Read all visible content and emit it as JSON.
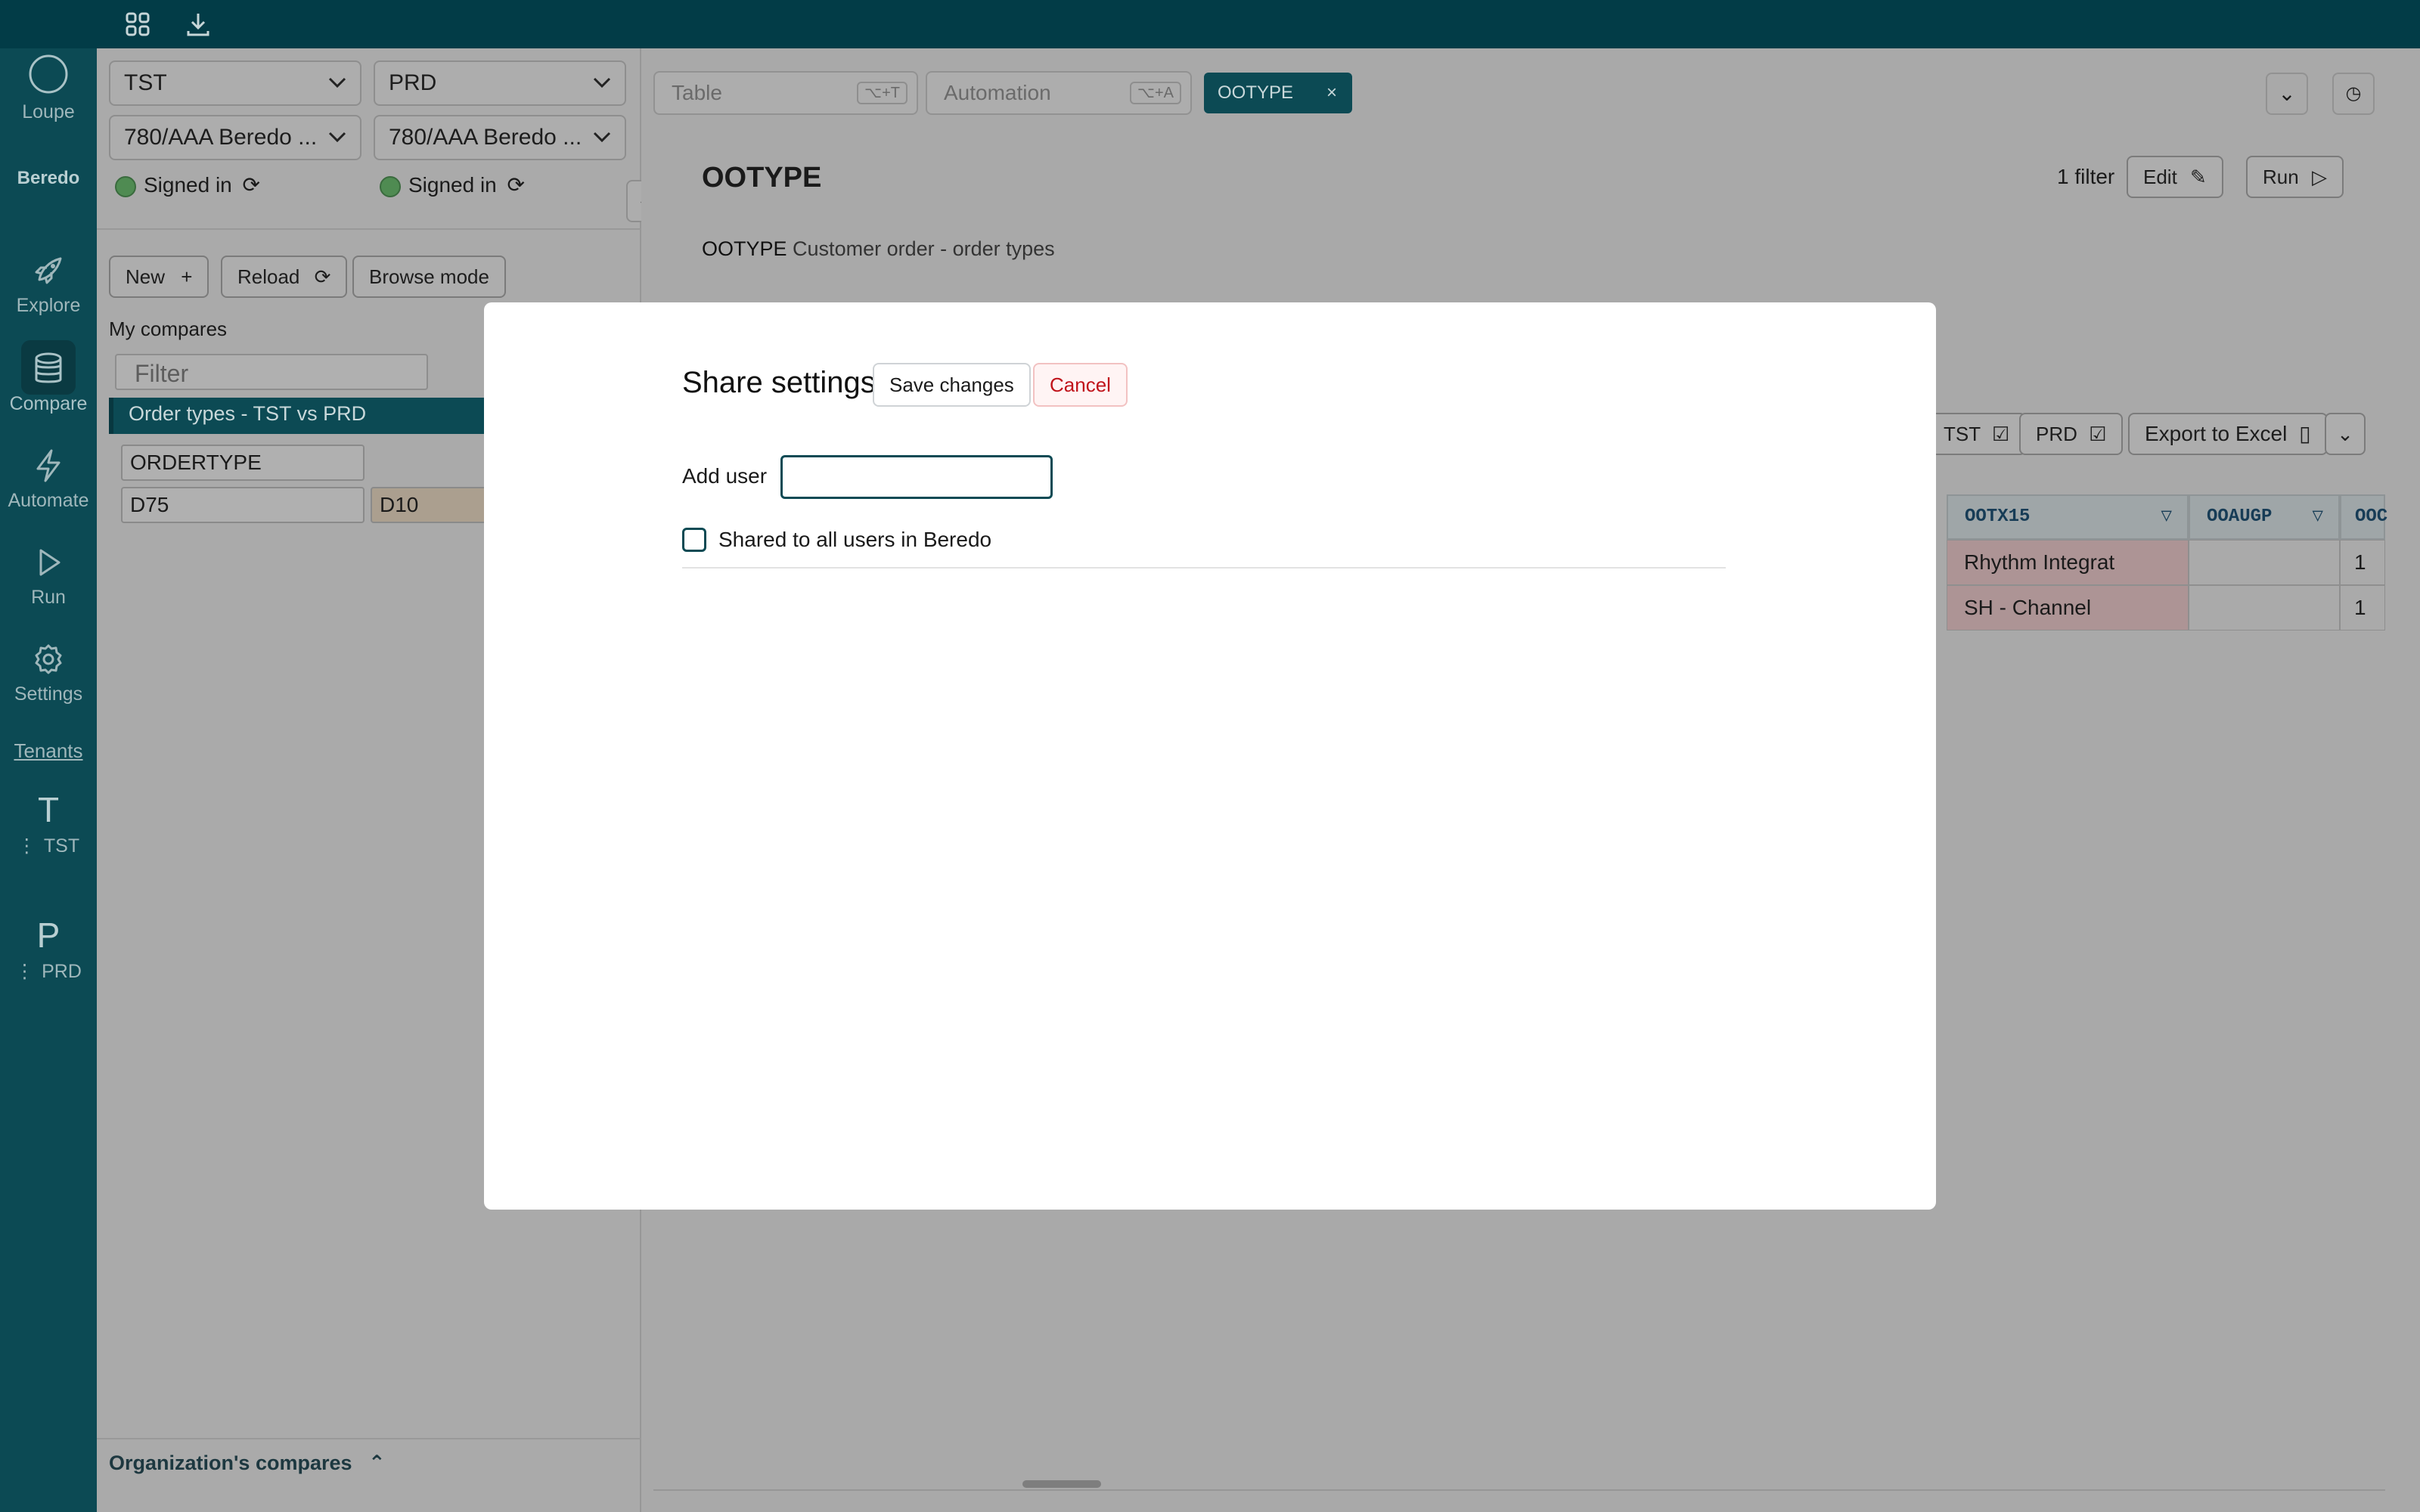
{
  "nav": {
    "brand_top": "Loupe",
    "brand_name": "Beredo",
    "items": [
      {
        "label": "Explore",
        "icon": "rocket-icon"
      },
      {
        "label": "Compare",
        "icon": "database-icon"
      },
      {
        "label": "Automate",
        "icon": "lightning-icon"
      },
      {
        "label": "Run",
        "icon": "play-icon"
      },
      {
        "label": "Settings",
        "icon": "gear-icon"
      }
    ],
    "tenants_label": "Tenants",
    "tenants": [
      {
        "letter": "T",
        "name": "TST"
      },
      {
        "letter": "P",
        "name": "PRD"
      }
    ]
  },
  "left_panel": {
    "env_left": "TST",
    "env_right": "PRD",
    "client_left": "780/AAA Beredo ...",
    "client_right": "780/AAA Beredo ...",
    "status_left": "Signed in",
    "status_right": "Signed in",
    "buttons": {
      "new": "New",
      "reload": "Reload",
      "browse": "Browse mode"
    },
    "my_compares_label": "My compares",
    "filter_placeholder": "Filter",
    "selected_compare": "Order types - TST vs PRD",
    "field_name": "ORDERTYPE",
    "value_left": "D75",
    "value_right": "D10",
    "org_compares_label": "Organization's compares"
  },
  "main": {
    "table_placeholder": "Table",
    "table_shortcut": "⌥+T",
    "automation_placeholder": "Automation",
    "automation_shortcut": "⌥+A",
    "active_chip": "OOTYPE",
    "title": "OOTYPE",
    "filter_count": "1 filter",
    "edit_label": "Edit",
    "run_label": "Run",
    "desc_code": "OOTYPE",
    "desc_text": "Customer order - order types",
    "toggle_tst": "TST",
    "toggle_prd": "PRD",
    "export_label": "Export to Excel",
    "columns": [
      "OOTX15",
      "OOAUGP",
      "OOC"
    ],
    "rows": [
      {
        "ootx15": "Rhythm Integrat",
        "ooaugp": "",
        "ooc": "1"
      },
      {
        "ootx15": "SH - Channel",
        "ooaugp": "",
        "ooc": "1"
      }
    ]
  },
  "modal": {
    "title": "Share settings",
    "save_label": "Save changes",
    "cancel_label": "Cancel",
    "add_user_label": "Add user",
    "add_user_value": "",
    "shared_label": "Shared to all users in Beredo",
    "shared_checked": false
  }
}
